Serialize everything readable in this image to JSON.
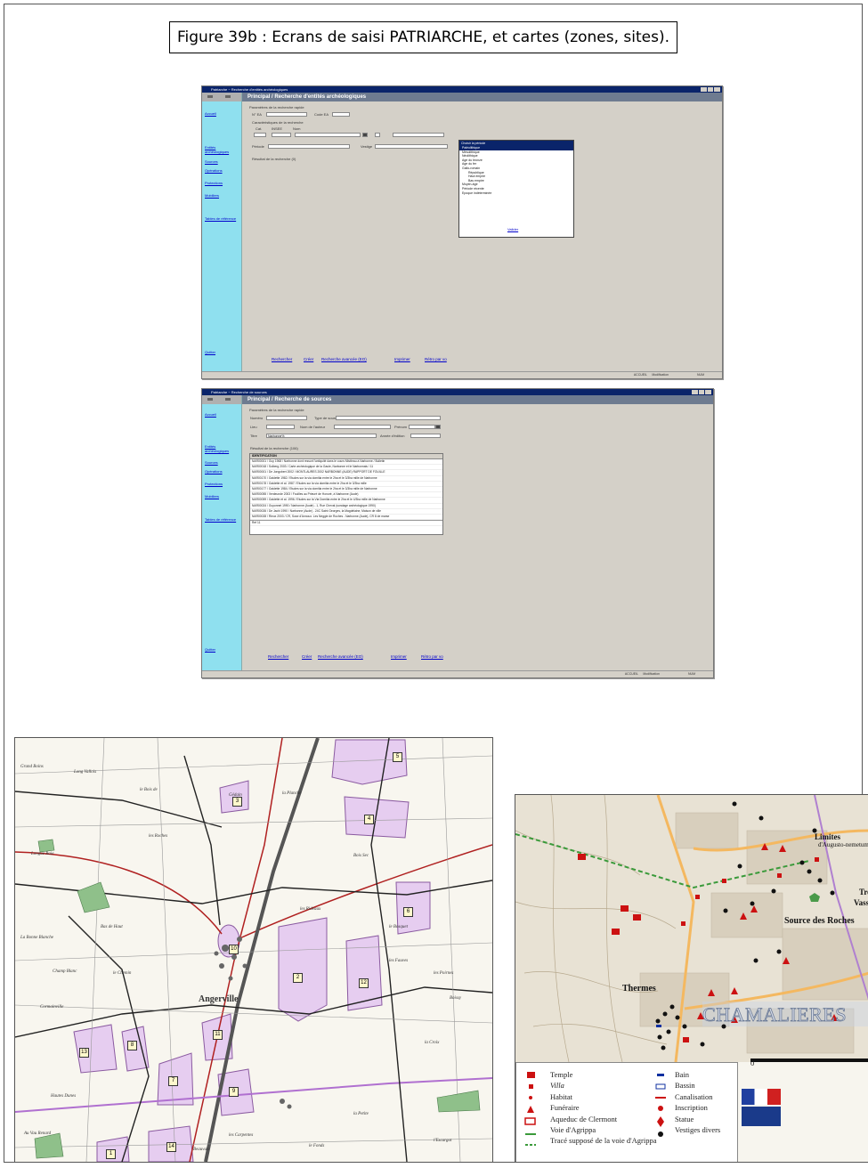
{
  "figure": {
    "title": "Figure 39b : Ecrans de saisi PATRIARCHE, et cartes (zones, sites)."
  },
  "screen1": {
    "titlebar": "Patriarche ~ Recherche d'entités archéologiques",
    "header": "Principal / Recherche d'entités archéologiques",
    "nav": [
      "Accueil",
      "Entités archéologiques",
      "Sources",
      "Opérations",
      "Protections",
      "Mobiliers",
      "Tables de référence",
      "Quitter"
    ],
    "fields": {
      "params": "Paramètres de la recherche rapide",
      "num": "N° EA",
      "code": "Code EA",
      "caract": "Caractéristiques de la recherche",
      "cat": "Cat.",
      "insee": "INSEE",
      "nom": "Nom",
      "periode": "Période",
      "vestige": "Vestige",
      "resultat": "Résultat de la recherche (0)"
    },
    "popup": {
      "title": "Choisir la période",
      "items": [
        "Paléolithique",
        "Mésolithique",
        "Néolithique",
        "Age du bronze",
        "Age du fer",
        "Gallo-romain",
        "République",
        "Haut empire",
        "Bas empire",
        "Moyen-âge",
        "Période récente",
        "Epoque indéterminée"
      ],
      "selected_index": 0,
      "sub_indexes": [
        6,
        7,
        8
      ],
      "button": "Valider"
    },
    "footer": [
      "Rechercher",
      "Créer",
      "Recherche avancée (EO)",
      "Imprimer",
      "Rétro par vo"
    ],
    "status": [
      "ACCUEIL",
      "Modification",
      "NUM"
    ]
  },
  "screen2": {
    "titlebar": "Patriarche ~ Recherche de sources",
    "header": "Principal / Recherche de sources",
    "nav": [
      "Accueil",
      "Entités archéologiques",
      "Sources",
      "Opérations",
      "Protections",
      "Mobiliers",
      "Tables de référence",
      "Quitter"
    ],
    "fields": {
      "params": "Paramètres de la recherche rapide",
      "numero": "Numéro",
      "type": "Type de source",
      "lieu": "Lieu",
      "auteur": "Nom de l'auteur",
      "prenom": "Prénom",
      "titre": "Titre",
      "titre_value": "Narbonne%",
      "annee": "Année d'édition",
      "resultat": "Résultat de la recherche (106)"
    },
    "grid": {
      "header": "IDENTIFICATION",
      "rows": [
        "NAR00001 / Guy 1968 / Narbonne dont ressort l'antiquité dans le cours Mistbrau à Narbonne / Bulletin",
        "NAR00018 / Solberg 2003 / Carte archéologique de la Gaule, Narbonne et le Narbonnais / 11",
        "NAR00001 / De Jongobert 2002 / MONTLAURES 2002 NARBONNE (AUDE) RAPPORT DE FOUILLE",
        "NAR00170 / Gaidette 1982 / Etudes sur la via domitia entre le 2ha et le 3/3ha mille de Narbonne",
        "NAR00178 / Gaidette et al. 1987 / Etudes sur la via domitia entre le 2ha et le 3/3ha mille",
        "NAR00177 / Gaidette 1984 / Etudes sur la via domitia entre le 2ha et le 3/3ha mille de Narbonne",
        "NAR00055 / Verdeunde 2003 / Fouilles au Prieuré de Honoré, à Narbonne (Aude)",
        "NAR00059 / Gaidette et al. 1996 / Etudes sur la Via Domitia entre le 2ha et le 4/3ha mille de Narbonne",
        "NAR00024 / Guyonnet 1990 / Narbonne (Aude) - 1, Rue Cheval (sondage archéologique 1990)",
        "NAR00026 / De Jachi 1990 / Narbonne (Aude) - 24C Saint Georges, la Magdelaine, Maison de ville",
        "NAR00028 / Rieux 2003 / CR, Suse d'Annoux. Les Neggie de Roches - Narbonne (Aude), CR 8 de marse"
      ],
      "footer_row": "Ref 11"
    },
    "footer": [
      "Rechercher",
      "Créer",
      "Recherche avancée (EO)",
      "Imprimer",
      "Rétro par vo"
    ],
    "status": [
      "ACCUEIL",
      "Modification",
      "NUM"
    ]
  },
  "map_left": {
    "town": "Angerville",
    "labels": [
      "Grand Boins",
      "Long Vallois",
      "le Bois de",
      "Gédain",
      "Longue Raie",
      "les Roches",
      "Bas de Haut",
      "La Bonne Blanche",
      "Champ Blanc",
      "les Fauves",
      "Cormainville",
      "les Poirnes",
      "Boissy",
      "la Planche",
      "Bois Sec",
      "le Bosquet",
      "les Rideaux",
      "Beauvais",
      "Hautes Dunes",
      "la Croix",
      "le Chemin",
      "la Petite",
      "les Carpentes",
      "le Fonds",
      "l'Escargot",
      "Au Vau Renard"
    ],
    "zone_numbers": [
      "5",
      "4",
      "3",
      "6",
      "2",
      "12",
      "13",
      "8",
      "7",
      "9",
      "11",
      "14",
      "1",
      "10"
    ]
  },
  "map_right": {
    "labels": {
      "limites": "Limites",
      "limites_sub": "d'Augusto-nemetum",
      "tre": "Tre",
      "vasso": "Vasso",
      "source": "Source des Roches",
      "thermes": "Thermes",
      "chamalieres": "CHAMALIERES"
    },
    "scale_zero": "0",
    "legend_left": [
      "Temple",
      "Villa",
      "Habitat",
      "Funéraire",
      "Aqueduc de Clermont",
      "Voie d'Agrippa",
      "Tracé supposé de la voie d'Agrippa"
    ],
    "legend_right": [
      "Bain",
      "Bassin",
      "Canalisation",
      "Inscription",
      "Statue",
      "Vestiges divers"
    ],
    "colors": {
      "red": "#cc1111",
      "green": "#4a9a4a",
      "purple": "#9a6ac0",
      "pink_zone": "#e9cdf0"
    }
  }
}
